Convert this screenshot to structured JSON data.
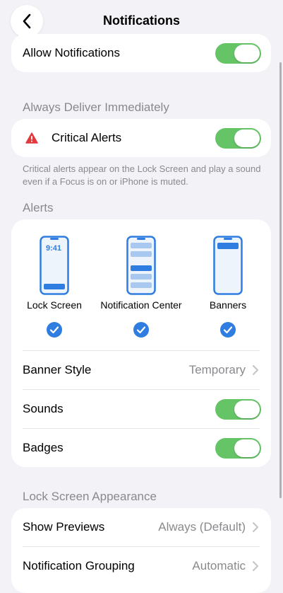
{
  "nav": {
    "title": "Notifications",
    "back_icon": "chevron-left-icon"
  },
  "allow": {
    "label": "Allow Notifications",
    "toggle_on": true
  },
  "always_deliver": {
    "header": "Always Deliver Immediately",
    "critical_label": "Critical Alerts",
    "critical_icon": "warning-triangle-icon",
    "toggle_on": true,
    "footnote": "Critical alerts appear on the Lock Screen and play a sound even if a Focus is on or iPhone is muted."
  },
  "alerts": {
    "header": "Alerts",
    "styles": [
      {
        "label": "Lock Screen",
        "time": "9:41",
        "checked": true
      },
      {
        "label": "Notification Center",
        "checked": true
      },
      {
        "label": "Banners",
        "checked": true
      }
    ],
    "banner_style": {
      "label": "Banner Style",
      "value": "Temporary"
    },
    "sounds": {
      "label": "Sounds",
      "toggle_on": true
    },
    "badges": {
      "label": "Badges",
      "toggle_on": true
    }
  },
  "lock_screen": {
    "header": "Lock Screen Appearance",
    "show_previews": {
      "label": "Show Previews",
      "value": "Always (Default)"
    },
    "grouping": {
      "label": "Notification Grouping",
      "value": "Automatic"
    }
  },
  "colors": {
    "toggle_on": "#65c466",
    "accent": "#2f7de1",
    "warning": "#e0393e",
    "phone_fill": "#c8dcf5"
  }
}
